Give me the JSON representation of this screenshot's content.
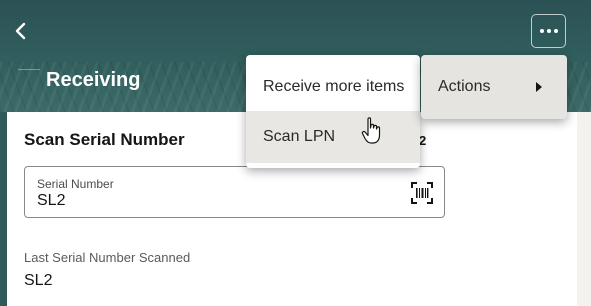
{
  "header": {
    "title": "Receiving",
    "back_icon": "chevron-left-icon",
    "more_icon": "ellipsis-icon"
  },
  "form": {
    "section_title": "Scan Serial Number",
    "partial_count": "2",
    "serial_field": {
      "label": "Serial Number",
      "value": "SL2",
      "scan_icon": "barcode-scan-icon"
    },
    "last_scanned": {
      "label": "Last Serial Number Scanned",
      "value": "SL2"
    }
  },
  "menu": {
    "items": [
      {
        "label": "Receive more items"
      },
      {
        "label": "Scan LPN"
      }
    ],
    "submenu": {
      "label": "Actions"
    }
  },
  "colors": {
    "header_bg": "#2f5a5c",
    "text_primary": "#161513",
    "menu_hover": "#e9e7e4"
  }
}
